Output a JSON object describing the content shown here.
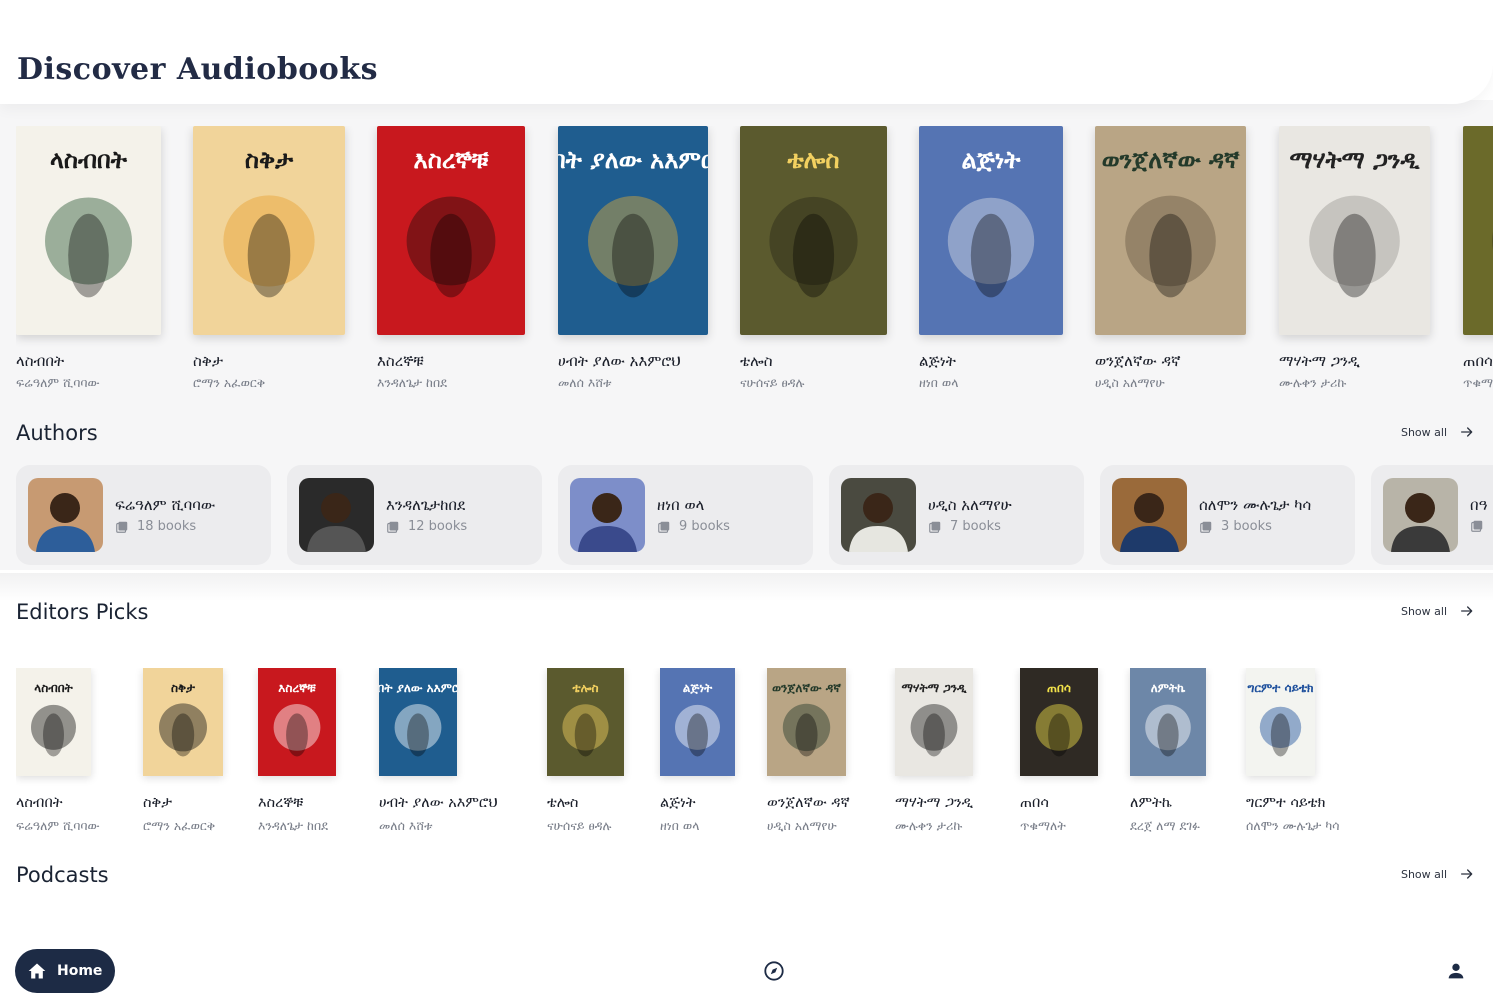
{
  "header": {
    "title": "Discover Audiobooks"
  },
  "featured_books": [
    {
      "title": "ላስብበት",
      "author": "ፍሬዓለም ሺባባው",
      "cover_text": "ላስብበት",
      "cover_bg": "#f4f2ea",
      "cover_fg": "#1a1a1a",
      "accent": "#2f5a3a"
    },
    {
      "title": "ስቅታ",
      "author": "ሮማን አፈወርቅ",
      "cover_text": "ስቅታ",
      "cover_bg": "#f1d49a",
      "cover_fg": "#1a1a1a",
      "accent": "#e9a232"
    },
    {
      "title": "እስረኞቹ",
      "author": "እንዳለጌታ ከበደ",
      "cover_text": "እስረኞቹ",
      "cover_bg": "#c8181e",
      "cover_fg": "#ffffff",
      "accent": "#2a0d0d"
    },
    {
      "title": "ሀብት ያለው አእምሮህ",
      "author": "መለሰ እሸቱ",
      "cover_text": "ሀብት ያለው አእምሮህ",
      "cover_bg": "#1f5d8f",
      "cover_fg": "#ffffff",
      "accent": "#d9a93a"
    },
    {
      "title": "ቴሎስ",
      "author": "ናሁሰናይ ፀዳሉ",
      "cover_text": "ቴሎስ",
      "cover_bg": "#5b5a2e",
      "cover_fg": "#f2d060",
      "accent": "#2b2a18"
    },
    {
      "title": "ልጅነት",
      "author": "ዘነበ ወላ",
      "cover_text": "ልጅነት",
      "cover_bg": "#5574b3",
      "cover_fg": "#ffffff",
      "accent": "#d8dce4"
    },
    {
      "title": "ወንጀለኛው ዳኛ",
      "author": "ሀዲስ አለማየሁ",
      "cover_text": "ወንጀለኛው ዳኛ",
      "cover_bg": "#b9a585",
      "cover_fg": "#243a2a",
      "accent": "#6b5a44"
    },
    {
      "title": "ማሃትማ ጋንዲ",
      "author": "ሙሉቀን ታሪኩ",
      "cover_text": "ማሃትማ ጋንዲ",
      "cover_bg": "#e9e7e2",
      "cover_fg": "#222222",
      "accent": "#9c9a95"
    },
    {
      "title": "ጠበሳ",
      "author": "ጥቁማለት",
      "cover_text": "ጠበሳ",
      "cover_bg": "#6b6a2a",
      "cover_fg": "#f1e14a",
      "accent": "#3a3a1a"
    }
  ],
  "authors_section": {
    "title": "Authors",
    "show_all": "Show all"
  },
  "authors": [
    {
      "name": "ፍሬዓለም ሺባባው",
      "count": "18 books",
      "avatar_bg": "#c79a72",
      "shirt": "#2d5e9a"
    },
    {
      "name": "እንዳለጌታከበደ",
      "count": "12 books",
      "avatar_bg": "#2a2a2a",
      "shirt": "#555555"
    },
    {
      "name": "ዘነበ ወላ",
      "count": "9 books",
      "avatar_bg": "#7d8ec9",
      "shirt": "#3a4a8c"
    },
    {
      "name": "ሀዲስ አለማየሁ",
      "count": "7 books",
      "avatar_bg": "#4a4a40",
      "shirt": "#e6e6e0"
    },
    {
      "name": "ሰለሞን ሙሉጌታ ካሳ",
      "count": "3 books",
      "avatar_bg": "#9a6a3a",
      "shirt": "#1e3a6a"
    },
    {
      "name": "በዓ",
      "count": "",
      "avatar_bg": "#b8b4a8",
      "shirt": "#3a3a3a"
    }
  ],
  "editors_section": {
    "title": "Editors Picks",
    "show_all": "Show all"
  },
  "editors_books": [
    {
      "title": "ላስብበት",
      "author": "ፍሬዓለም ሺባባው",
      "cover_text": "ላስብበት",
      "cover_bg": "#f4f2ea",
      "cover_fg": "#1a1a1a"
    },
    {
      "title": "ስቅታ",
      "author": "ሮማን አፈወርቅ",
      "cover_text": "ስቅታ",
      "cover_bg": "#f1d49a",
      "cover_fg": "#1a1a1a"
    },
    {
      "title": "እስረኞቹ",
      "author": "እንዳለጌታ ከበደ",
      "cover_text": "እስረኞቹ",
      "cover_bg": "#c8181e",
      "cover_fg": "#ffffff"
    },
    {
      "title": "ሀብት ያለው አእምሮህ",
      "author": "መለሰ እሸቱ",
      "cover_text": "ሀብት ያለው አእምሮህ",
      "cover_bg": "#1f5d8f",
      "cover_fg": "#ffffff"
    },
    {
      "title": "ቴሎስ",
      "author": "ናሁሰናይ ፀዳሉ",
      "cover_text": "ቴሎስ",
      "cover_bg": "#5b5a2e",
      "cover_fg": "#f2d060"
    },
    {
      "title": "ልጅነት",
      "author": "ዘነበ ወላ",
      "cover_text": "ልጅነት",
      "cover_bg": "#5574b3",
      "cover_fg": "#ffffff"
    },
    {
      "title": "ወንጀለኛው ዳኛ",
      "author": "ሀዲስ አለማየሁ",
      "cover_text": "ወንጀለኛው ዳኛ",
      "cover_bg": "#b9a585",
      "cover_fg": "#243a2a"
    },
    {
      "title": "ማሃትማ ጋንዲ",
      "author": "ሙሉቀን ታሪኩ",
      "cover_text": "ማሃትማ ጋንዲ",
      "cover_bg": "#e9e7e2",
      "cover_fg": "#222222"
    },
    {
      "title": "ጠበሳ",
      "author": "ጥቁማለት",
      "cover_text": "ጠበሳ",
      "cover_bg": "#2f2a24",
      "cover_fg": "#f1e14a"
    },
    {
      "title": "ለምትኬ",
      "author": "ደረጀ ለማ ደገፉ",
      "cover_text": "ለምትኬ",
      "cover_bg": "#6d87a8",
      "cover_fg": "#ffffff"
    },
    {
      "title": "ግርምተ ሳይቴክ",
      "author": "ሰለሞን ሙሉጌታ ካሳ",
      "cover_text": "ግርምተ ሳይቴክ",
      "cover_bg": "#f3f4f0",
      "cover_fg": "#1d4f9c"
    }
  ],
  "podcasts_section": {
    "title": "Podcasts",
    "show_all": "Show all"
  },
  "nav": {
    "home_label": "Home"
  },
  "colors": {
    "nav_home_bg": "#1d2b45",
    "text_primary": "#1a2333",
    "text_secondary": "#7a7f8a",
    "card_bg": "#ececee"
  }
}
